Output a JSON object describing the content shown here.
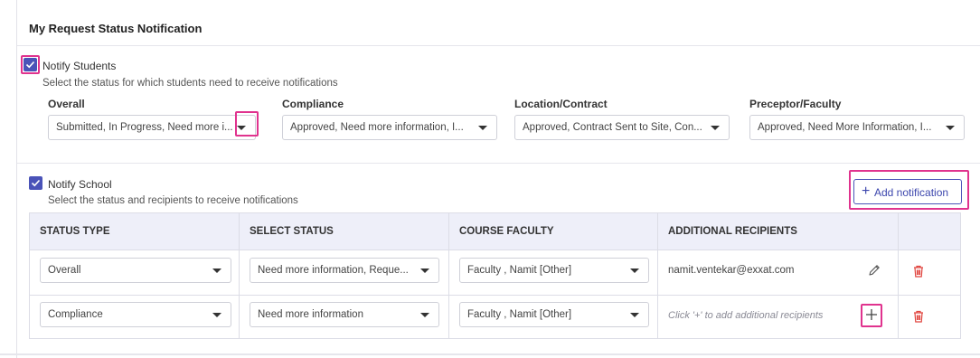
{
  "section": {
    "title": "My Request Status Notification"
  },
  "students": {
    "checked": true,
    "label": "Notify Students",
    "hint": "Select the status for which students need to receive notifications",
    "filters": [
      {
        "label": "Overall",
        "value": "Submitted, In Progress, Need more i..."
      },
      {
        "label": "Compliance",
        "value": "Approved, Need more information, I..."
      },
      {
        "label": "Location/Contract",
        "value": "Approved, Contract Sent to Site, Con..."
      },
      {
        "label": "Preceptor/Faculty",
        "value": "Approved, Need More Information, I..."
      }
    ]
  },
  "school": {
    "checked": true,
    "label": "Notify School",
    "hint": "Select the status and recipients to receive notifications",
    "add_button": {
      "icon": "plus-icon",
      "label": "Add notification"
    }
  },
  "table": {
    "headers": [
      "STATUS TYPE",
      "SELECT STATUS",
      "COURSE FACULTY",
      "ADDITIONAL RECIPIENTS"
    ],
    "rows": [
      {
        "status_type": "Overall",
        "select_status": "Need more information, Reque...",
        "course_faculty": "Faculty , Namit [Other]",
        "recipients": "namit.ventekar@exxat.com",
        "action_icon": "pencil-icon"
      },
      {
        "status_type": "Compliance",
        "select_status": "Need more information",
        "course_faculty": "Faculty , Namit [Other]",
        "recipients_placeholder": "Click '+' to add additional recipients",
        "action_icon": "plus-icon"
      }
    ]
  },
  "colors": {
    "accent": "#4a53b8",
    "highlight": "#e0338e",
    "delete": "#e0443e",
    "header_bg": "#eeeff9"
  }
}
